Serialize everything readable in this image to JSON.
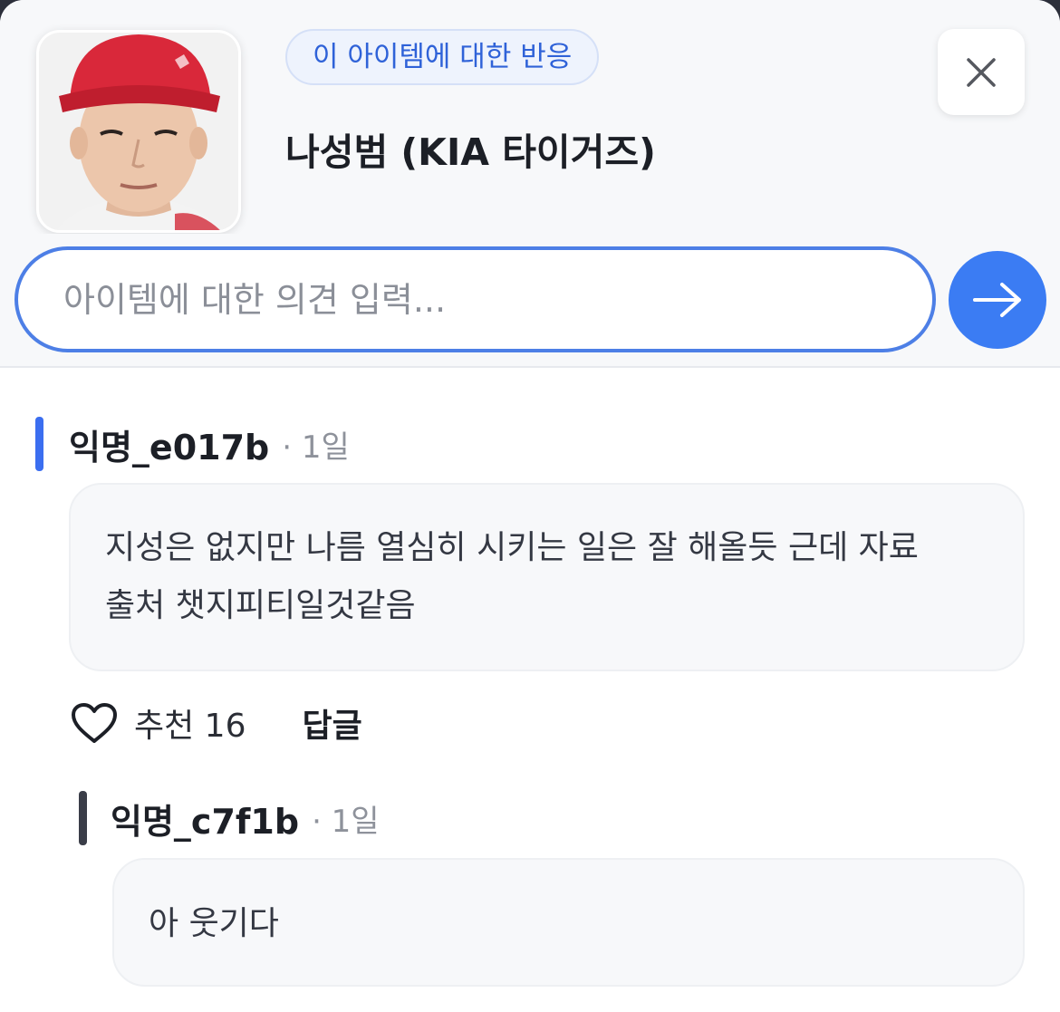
{
  "header": {
    "reaction_label": "이 아이템에 대한 반응",
    "item_title": "나성범 (KIA 타이거즈)"
  },
  "input": {
    "placeholder": "아이템에 대한 의견 입력...",
    "value": ""
  },
  "colors": {
    "accent": "#3b7cf3",
    "comment_bar": "#3b6ef0",
    "reply_bar": "#3a3d48"
  },
  "comments": [
    {
      "author": "익명_e017b",
      "time": "· 1일",
      "body_line1": "지성은 없지만 나름 열심히 시키는 일은 잘 해올듯 근데 자료",
      "body_line2": "출처 챗지피티일것같음",
      "like_label": "추천 16",
      "reply_label": "답글",
      "replies": [
        {
          "author": "익명_c7f1b",
          "time": "· 1일",
          "body": "아 웃기다"
        }
      ]
    }
  ]
}
